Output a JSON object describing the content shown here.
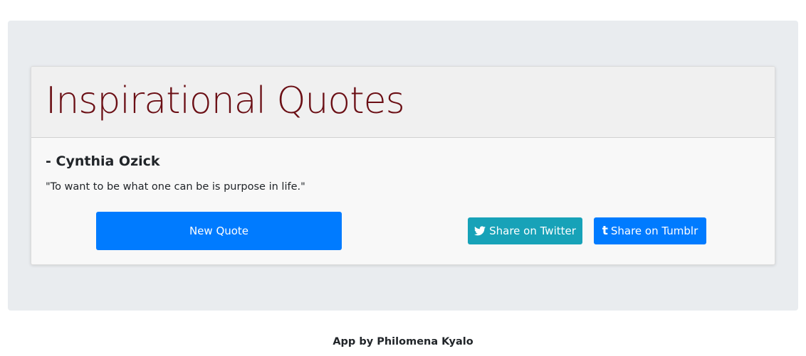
{
  "header": {
    "title": "Inspirational Quotes"
  },
  "quote": {
    "author": "- Cynthia Ozick",
    "text": "\"To want to be what one can be is purpose in life.\""
  },
  "buttons": {
    "new_quote": "New Quote",
    "twitter": "Share on Twitter",
    "tumblr": "Share on Tumblr"
  },
  "icons": {
    "twitter": "twitter-icon",
    "tumblr": "tumblr-icon"
  },
  "footer": {
    "credit": "App by Philomena Kyalo"
  },
  "colors": {
    "title": "#6b0f15",
    "primary": "#007bff",
    "info": "#17a2b8",
    "background": "#e9ecef"
  }
}
